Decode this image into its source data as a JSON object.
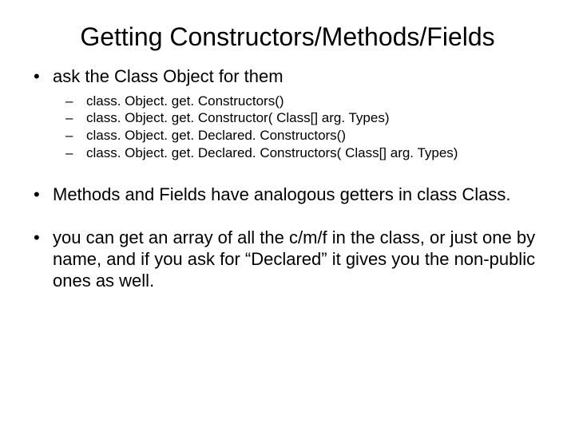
{
  "title": "Getting Constructors/Methods/Fields",
  "bullets": [
    {
      "text": "ask the Class Object for them",
      "sub": [
        "class. Object. get. Constructors()",
        "class. Object. get. Constructor( Class[] arg. Types)",
        "class. Object. get. Declared. Constructors()",
        "class. Object. get. Declared. Constructors( Class[] arg. Types)"
      ]
    },
    {
      "text": "Methods and Fields have analogous getters in class Class.",
      "sub": []
    },
    {
      "text": "you can get an array of all the c/m/f in the class, or just one by name, and if you ask for “Declared” it gives you the non-public ones as well.",
      "sub": []
    }
  ]
}
